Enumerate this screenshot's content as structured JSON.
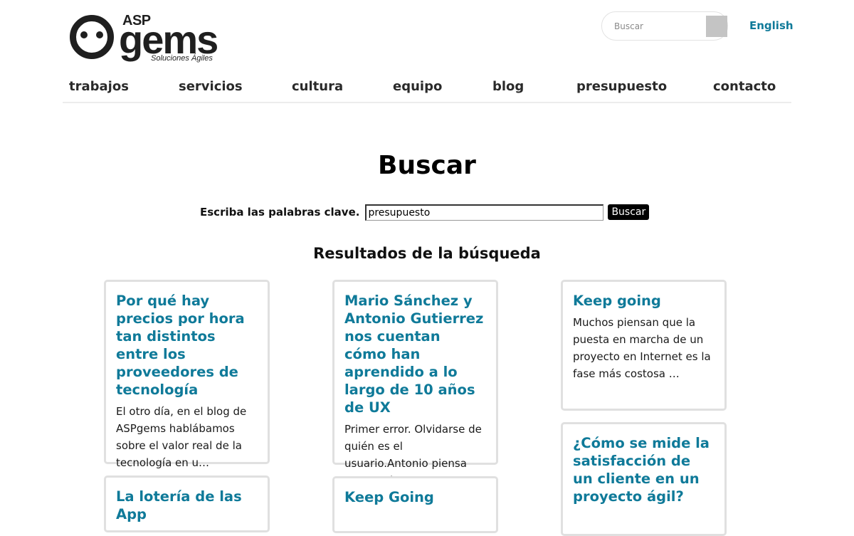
{
  "header": {
    "logo": {
      "asp": "ASP",
      "gems": "gems",
      "tagline": "Soluciones Ágiles"
    },
    "search": {
      "placeholder": "Buscar"
    },
    "language_link": "English"
  },
  "nav": {
    "items": [
      {
        "label": "trabajos"
      },
      {
        "label": "servicios"
      },
      {
        "label": "cultura"
      },
      {
        "label": "equipo"
      },
      {
        "label": "blog"
      },
      {
        "label": "presupuesto"
      },
      {
        "label": "contacto"
      }
    ]
  },
  "main": {
    "title": "Buscar",
    "search_form": {
      "label": "Escriba las palabras clave.",
      "value": "presupuesto",
      "button": "Buscar"
    },
    "results_title": "Resultados de la búsqueda",
    "results": [
      {
        "title": "Por qué hay precios por hora tan distintos entre los proveedores de tecnología",
        "excerpt": "El otro día, en el blog de ASPgems hablábamos sobre el valor real de la tecnología en u…"
      },
      {
        "title": "Mario Sánchez y Antonio Gutierrez nos cuentan cómo han aprendido a lo largo de 10 años de UX",
        "excerpt": " Primer error. Olvidarse de quién es el usuario.Antonio piensa que es algo que …"
      },
      {
        "title": "Keep going",
        "excerpt": "Muchos piensan que la puesta en marcha de un proyecto en Internet es la fase más costosa …"
      },
      {
        "title": "La lotería de las App",
        "excerpt": ""
      },
      {
        "title": "Keep Going",
        "excerpt": ""
      },
      {
        "title": "¿Cómo se mide la satisfacción de un cliente en un proyecto ágil?",
        "excerpt": ""
      }
    ]
  },
  "colors": {
    "link": "#0f7a99",
    "text": "#1a1a1a",
    "card_border": "#e0e0e0",
    "button_bg": "#000000"
  }
}
